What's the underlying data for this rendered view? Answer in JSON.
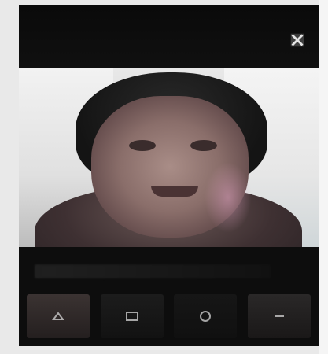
{
  "window": {
    "title": ""
  },
  "header": {
    "close_icon": "close-icon"
  },
  "video": {
    "description_icon": "video-frame"
  },
  "caption": {
    "text": ""
  },
  "actions": [
    {
      "icon": "action-icon-1"
    },
    {
      "icon": "action-icon-2"
    },
    {
      "icon": "action-icon-3"
    },
    {
      "icon": "action-icon-4"
    }
  ],
  "colors": {
    "background": "#0b0b0b",
    "frame": "#e9e9e9",
    "icon": "#d6d6d6"
  }
}
